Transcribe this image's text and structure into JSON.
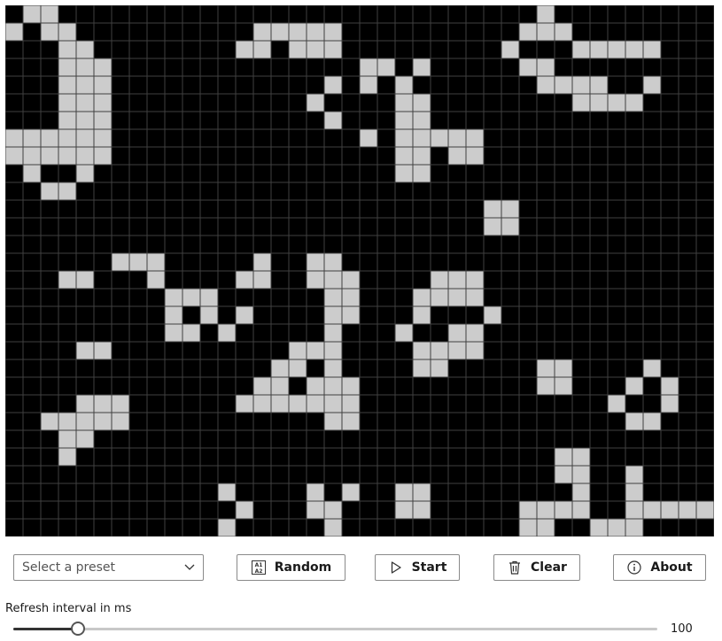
{
  "grid": {
    "columns": 40,
    "rows": 30,
    "alive_color": "#cccccc",
    "dead_color": "#000000",
    "line_color": "#404040",
    "alive_cells": [
      [
        1,
        0
      ],
      [
        2,
        0
      ],
      [
        0,
        1
      ],
      [
        2,
        1
      ],
      [
        3,
        1
      ],
      [
        3,
        2
      ],
      [
        4,
        2
      ],
      [
        3,
        3
      ],
      [
        4,
        3
      ],
      [
        5,
        3
      ],
      [
        3,
        4
      ],
      [
        4,
        4
      ],
      [
        5,
        4
      ],
      [
        3,
        5
      ],
      [
        4,
        5
      ],
      [
        5,
        5
      ],
      [
        3,
        6
      ],
      [
        4,
        6
      ],
      [
        5,
        6
      ],
      [
        0,
        7
      ],
      [
        1,
        7
      ],
      [
        2,
        7
      ],
      [
        3,
        7
      ],
      [
        4,
        7
      ],
      [
        5,
        7
      ],
      [
        0,
        8
      ],
      [
        1,
        8
      ],
      [
        2,
        8
      ],
      [
        3,
        8
      ],
      [
        4,
        8
      ],
      [
        5,
        8
      ],
      [
        1,
        9
      ],
      [
        4,
        9
      ],
      [
        2,
        10
      ],
      [
        3,
        10
      ],
      [
        14,
        1
      ],
      [
        15,
        1
      ],
      [
        16,
        1
      ],
      [
        17,
        1
      ],
      [
        18,
        1
      ],
      [
        13,
        2
      ],
      [
        14,
        2
      ],
      [
        16,
        2
      ],
      [
        17,
        2
      ],
      [
        18,
        2
      ],
      [
        20,
        3
      ],
      [
        21,
        3
      ],
      [
        23,
        3
      ],
      [
        18,
        4
      ],
      [
        20,
        4
      ],
      [
        22,
        4
      ],
      [
        17,
        5
      ],
      [
        22,
        5
      ],
      [
        23,
        5
      ],
      [
        18,
        6
      ],
      [
        22,
        6
      ],
      [
        23,
        6
      ],
      [
        20,
        7
      ],
      [
        22,
        7
      ],
      [
        23,
        7
      ],
      [
        24,
        7
      ],
      [
        25,
        7
      ],
      [
        26,
        7
      ],
      [
        22,
        8
      ],
      [
        23,
        8
      ],
      [
        25,
        8
      ],
      [
        26,
        8
      ],
      [
        22,
        9
      ],
      [
        23,
        9
      ],
      [
        30,
        0
      ],
      [
        29,
        1
      ],
      [
        30,
        1
      ],
      [
        31,
        1
      ],
      [
        28,
        2
      ],
      [
        32,
        2
      ],
      [
        33,
        2
      ],
      [
        34,
        2
      ],
      [
        35,
        2
      ],
      [
        36,
        2
      ],
      [
        29,
        3
      ],
      [
        30,
        3
      ],
      [
        30,
        4
      ],
      [
        31,
        4
      ],
      [
        32,
        4
      ],
      [
        33,
        4
      ],
      [
        36,
        4
      ],
      [
        32,
        5
      ],
      [
        33,
        5
      ],
      [
        34,
        5
      ],
      [
        35,
        5
      ],
      [
        27,
        11
      ],
      [
        28,
        11
      ],
      [
        27,
        12
      ],
      [
        28,
        12
      ],
      [
        6,
        14
      ],
      [
        7,
        14
      ],
      [
        8,
        14
      ],
      [
        14,
        14
      ],
      [
        17,
        14
      ],
      [
        18,
        14
      ],
      [
        3,
        15
      ],
      [
        4,
        15
      ],
      [
        8,
        15
      ],
      [
        13,
        15
      ],
      [
        14,
        15
      ],
      [
        17,
        15
      ],
      [
        18,
        15
      ],
      [
        19,
        15
      ],
      [
        24,
        15
      ],
      [
        25,
        15
      ],
      [
        26,
        15
      ],
      [
        9,
        16
      ],
      [
        10,
        16
      ],
      [
        11,
        16
      ],
      [
        18,
        16
      ],
      [
        19,
        16
      ],
      [
        23,
        16
      ],
      [
        24,
        16
      ],
      [
        25,
        16
      ],
      [
        26,
        16
      ],
      [
        9,
        17
      ],
      [
        11,
        17
      ],
      [
        13,
        17
      ],
      [
        18,
        17
      ],
      [
        19,
        17
      ],
      [
        23,
        17
      ],
      [
        27,
        17
      ],
      [
        9,
        18
      ],
      [
        10,
        18
      ],
      [
        12,
        18
      ],
      [
        18,
        18
      ],
      [
        22,
        18
      ],
      [
        25,
        18
      ],
      [
        26,
        18
      ],
      [
        4,
        19
      ],
      [
        16,
        19
      ],
      [
        17,
        19
      ],
      [
        18,
        19
      ],
      [
        23,
        19
      ],
      [
        24,
        19
      ],
      [
        25,
        19
      ],
      [
        26,
        19
      ],
      [
        4,
        19
      ],
      [
        5,
        19
      ],
      [
        15,
        20
      ],
      [
        16,
        20
      ],
      [
        18,
        20
      ],
      [
        23,
        20
      ],
      [
        24,
        20
      ],
      [
        30,
        20
      ],
      [
        31,
        20
      ],
      [
        36,
        20
      ],
      [
        14,
        21
      ],
      [
        15,
        21
      ],
      [
        17,
        21
      ],
      [
        18,
        21
      ],
      [
        19,
        21
      ],
      [
        30,
        21
      ],
      [
        31,
        21
      ],
      [
        35,
        21
      ],
      [
        37,
        21
      ],
      [
        4,
        22
      ],
      [
        5,
        22
      ],
      [
        6,
        22
      ],
      [
        13,
        22
      ],
      [
        14,
        22
      ],
      [
        15,
        22
      ],
      [
        16,
        22
      ],
      [
        17,
        22
      ],
      [
        18,
        22
      ],
      [
        19,
        22
      ],
      [
        34,
        22
      ],
      [
        37,
        22
      ],
      [
        2,
        23
      ],
      [
        3,
        23
      ],
      [
        4,
        23
      ],
      [
        5,
        23
      ],
      [
        6,
        23
      ],
      [
        18,
        23
      ],
      [
        19,
        23
      ],
      [
        35,
        23
      ],
      [
        36,
        23
      ],
      [
        3,
        24
      ],
      [
        4,
        24
      ],
      [
        3,
        25
      ],
      [
        31,
        25
      ],
      [
        32,
        25
      ],
      [
        31,
        26
      ],
      [
        32,
        26
      ],
      [
        35,
        26
      ],
      [
        22,
        27
      ],
      [
        23,
        27
      ],
      [
        32,
        27
      ],
      [
        35,
        27
      ],
      [
        22,
        28
      ],
      [
        23,
        28
      ],
      [
        35,
        28
      ],
      [
        36,
        28
      ],
      [
        37,
        28
      ],
      [
        38,
        28
      ],
      [
        39,
        28
      ],
      [
        12,
        27
      ],
      [
        17,
        27
      ],
      [
        19,
        27
      ],
      [
        13,
        28
      ],
      [
        17,
        28
      ],
      [
        18,
        28
      ],
      [
        29,
        28
      ],
      [
        30,
        28
      ],
      [
        31,
        28
      ],
      [
        32,
        28
      ],
      [
        36,
        28
      ],
      [
        37,
        28
      ],
      [
        38,
        28
      ],
      [
        39,
        28
      ],
      [
        12,
        29
      ],
      [
        18,
        29
      ],
      [
        29,
        29
      ],
      [
        30,
        29
      ],
      [
        33,
        29
      ],
      [
        34,
        29
      ],
      [
        35,
        29
      ]
    ]
  },
  "preset": {
    "placeholder": "Select a preset"
  },
  "buttons": {
    "random": "Random",
    "start": "Start",
    "clear": "Clear",
    "about": "About",
    "random_icon_text_top": "A1",
    "random_icon_text_bottom": "A2"
  },
  "refresh": {
    "label": "Refresh interval in ms",
    "value": "100",
    "fraction": 0.1
  }
}
